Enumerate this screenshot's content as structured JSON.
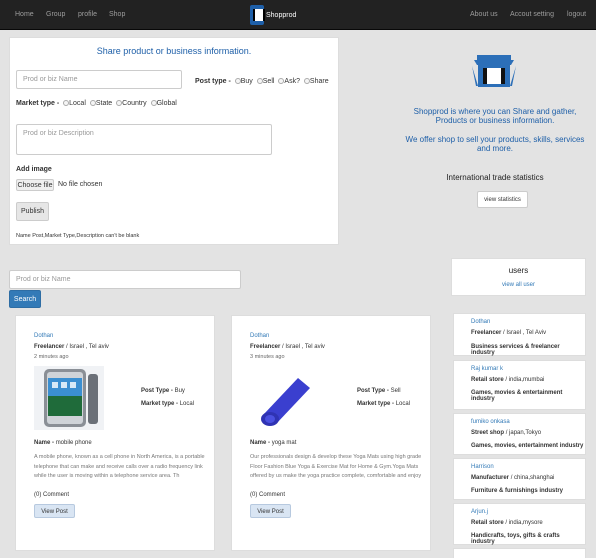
{
  "nav": {
    "left": [
      "Home",
      "Group",
      "profile",
      "Shop"
    ],
    "brand": "Shopprod",
    "right": [
      "About us",
      "Accout setting",
      "logout"
    ]
  },
  "share": {
    "title": "Share product or business information.",
    "name_placeholder": "Prod or biz Name",
    "post_type_label": "Post type -",
    "post_types": [
      "Buy",
      "Sell",
      "Ask?",
      "Share"
    ],
    "market_type_label": "Market type -",
    "market_types": [
      "Local",
      "State",
      "Country",
      "Global"
    ],
    "desc_placeholder": "Prod or biz Description",
    "add_image_label": "Add image",
    "choose_file": "Choose file",
    "no_file": "No file chosen",
    "publish": "Publish",
    "error": "Name Post,Market Type,Description can't be blank"
  },
  "about": {
    "line1": "Shopprod is where you can Share and gather, Products or business information.",
    "line2": "We offer shop to sell your products, skills, services and more.",
    "stats_title": "International trade statistics",
    "stats_button": "view statistics"
  },
  "search": {
    "placeholder": "Prod or biz Name",
    "button": "Search"
  },
  "users_panel": {
    "title": "users",
    "link": "view all user"
  },
  "posts": [
    {
      "user": "Dothan",
      "role": "Freelancer",
      "location": "/ Israel , Tel aviv",
      "time": "2 minutes ago",
      "post_type_label": "Post Type -",
      "post_type": "Buy",
      "market_type_label": "Market type -",
      "market_type": "Local",
      "name_label": "Name -",
      "name": "mobile phone",
      "description": "A mobile phone, known as a cell phone in North America, is a portable telephone that can make and receive calls over a radio frequency link while the user is moving within a telephone service area. Th",
      "comments": "(0) Comment",
      "button": "View Post",
      "image": "phone"
    },
    {
      "user": "Dothan",
      "role": "Freelancer",
      "location": "/ Israel , Tel aviv",
      "time": "3 minutes ago",
      "post_type_label": "Post Type -",
      "post_type": "Sell",
      "market_type_label": "Market type -",
      "market_type": "Local",
      "name_label": "Name -",
      "name": "yoga mat",
      "description": "Our professionals design & develop these Yoga Mats using high grade Floor Fashion Blue Yoga & Exercise Mat for Home & Gym.Yoga Mats offered by us make the yoga practice complete, comfortable and enjoy",
      "comments": "(0) Comment",
      "button": "View Post",
      "image": "yoga-mat"
    }
  ],
  "users": [
    {
      "name": "Dothan",
      "role": "Freelancer",
      "location": "/ Israel , Tel Aviv",
      "industry": "Business services & freelancer industry"
    },
    {
      "name": "Raj kumar k",
      "role": "Retail store",
      "location": "/ india,mumbai",
      "industry": "Games, movies & entertainment industry"
    },
    {
      "name": "fumiko onkasa",
      "role": "Street shop",
      "location": "/ japan,Tokyo",
      "industry": "Games, movies, entertainment industry"
    },
    {
      "name": "Harrison",
      "role": "Manufacturer",
      "location": "/ china,shanghai",
      "industry": "Furniture & furnishings industry"
    },
    {
      "name": "Arjun.j",
      "role": "Retail store",
      "location": "/ india,mysore",
      "industry": "Handicrafts, toys, gifts & crafts industry"
    }
  ]
}
